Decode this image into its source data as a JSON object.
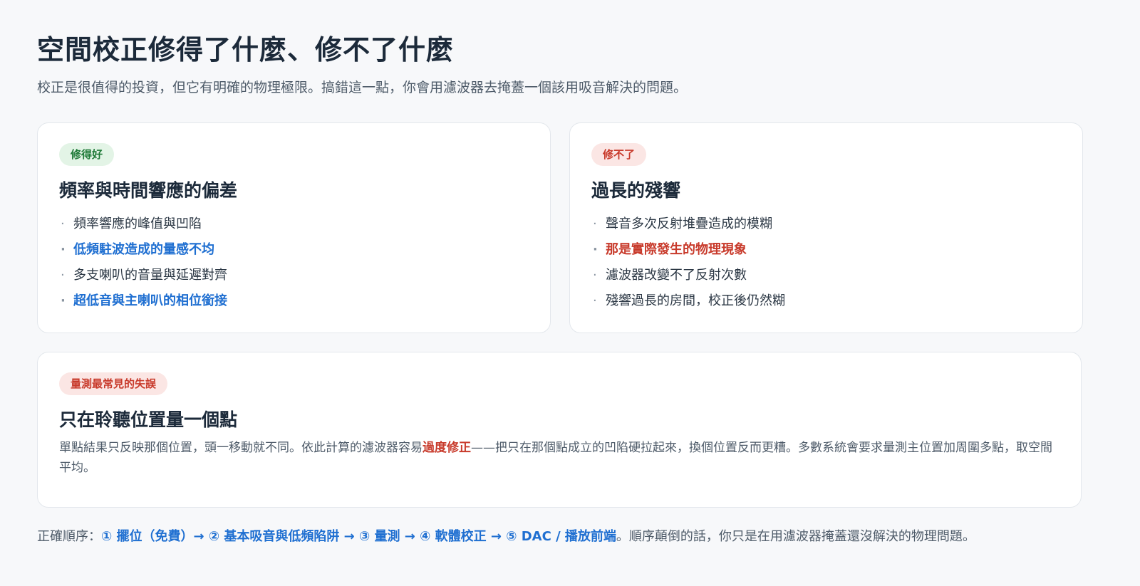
{
  "header": {
    "title": "空間校正修得了什麼、修不了什麼",
    "subtitle": "校正是很值得的投資，但它有明確的物理極限。搞錯這一點，你會用濾波器去掩蓋一個該用吸音解決的問題。"
  },
  "cards": {
    "fixable": {
      "badge": "修得好",
      "title": "頻率與時間響應的偏差",
      "items": [
        "頻率響應的峰值與凹陷",
        "低頻駐波造成的量感不均",
        "多支喇叭的音量與延遲對齊",
        "超低音與主喇叭的相位銜接"
      ]
    },
    "unfixable": {
      "badge": "修不了",
      "title": "過長的殘響",
      "items": [
        "聲音多次反射堆疊造成的模糊",
        "那是實際發生的物理現象",
        "濾波器改變不了反射次數",
        "殘響過長的房間，校正後仍然糊"
      ]
    },
    "mistake": {
      "badge": "量測最常見的失誤",
      "title": "只在聆聽位置量一個點",
      "text_before": "單點結果只反映那個位置，頭一移動就不同。依此計算的濾波器容易",
      "text_emphasis": "過度修正",
      "text_after": "——把只在那個點成立的凹陷硬拉起來，換個位置反而更糟。多數系統會要求量測主位置加周圍多點，取空間平均。"
    }
  },
  "footer": {
    "label": "正確順序：",
    "steps": "① 擺位（免費）→ ② 基本吸音與低頻陷阱 → ③ 量測 → ④ 軟體校正 → ⑤ DAC / 播放前端",
    "tail": "。順序顛倒的話，你只是在用濾波器掩蓋還沒解決的物理問題。"
  },
  "bullet": "·",
  "colors": {
    "accent_blue": "#1f6fd1",
    "accent_red": "#c83a2b",
    "accent_green": "#1f7a38",
    "background": "#f7f8fa"
  }
}
